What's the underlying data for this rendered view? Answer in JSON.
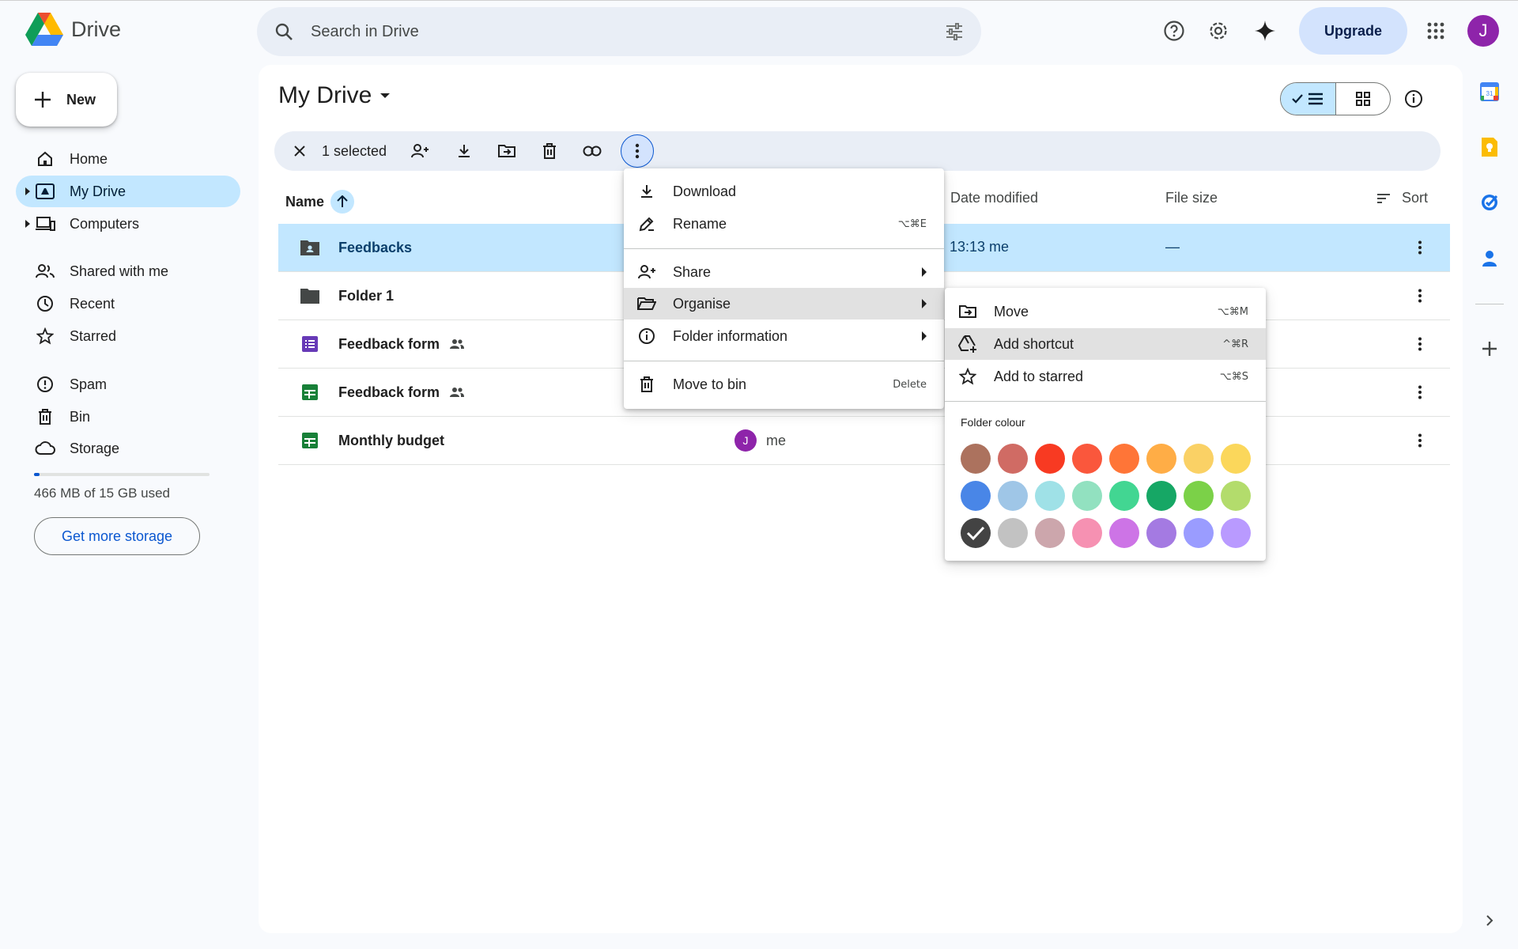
{
  "app": {
    "name": "Drive"
  },
  "search": {
    "placeholder": "Search in Drive"
  },
  "header": {
    "upgrade_label": "Upgrade",
    "avatar_initial": "J"
  },
  "sidebar": {
    "new_label": "New",
    "items": [
      {
        "label": "Home"
      },
      {
        "label": "My Drive"
      },
      {
        "label": "Computers"
      },
      {
        "label": "Shared with me"
      },
      {
        "label": "Recent"
      },
      {
        "label": "Starred"
      },
      {
        "label": "Spam"
      },
      {
        "label": "Bin"
      },
      {
        "label": "Storage"
      }
    ],
    "storage_used_fraction": 0.03,
    "storage_text": "466 MB of 15 GB used",
    "get_more_storage": "Get more storage"
  },
  "main": {
    "title": "My Drive",
    "selection_count": "1 selected",
    "columns": {
      "name": "Name",
      "date_modified": "Date modified",
      "file_size": "File size",
      "sort": "Sort"
    },
    "rows": [
      {
        "name": "Feedbacks",
        "type": "shared-folder",
        "date_modified": "13:13 me",
        "file_size": "—",
        "shared": false,
        "selected": true
      },
      {
        "name": "Folder 1",
        "type": "folder",
        "shared": false
      },
      {
        "name": "Feedback form",
        "type": "forms",
        "shared": true
      },
      {
        "name": "Feedback form",
        "type": "sheets",
        "shared": true
      },
      {
        "name": "Monthly budget",
        "type": "sheets",
        "shared": false,
        "owner": "me",
        "owner_initial": "J"
      }
    ]
  },
  "context_menu": {
    "items": [
      {
        "label": "Download",
        "icon": "download-icon"
      },
      {
        "label": "Rename",
        "icon": "rename-icon",
        "shortcut": "⌥⌘E"
      },
      {
        "label": "Share",
        "icon": "share-icon",
        "submenu": true
      },
      {
        "label": "Organise",
        "icon": "organise-icon",
        "submenu": true,
        "highlighted": true
      },
      {
        "label": "Folder information",
        "icon": "info-icon",
        "submenu": true
      },
      {
        "label": "Move to bin",
        "icon": "bin-icon",
        "shortcut": "Delete"
      }
    ]
  },
  "organise_menu": {
    "items": [
      {
        "label": "Move",
        "icon": "move-icon",
        "shortcut": "⌥⌘M"
      },
      {
        "label": "Add shortcut",
        "icon": "add-shortcut-icon",
        "shortcut": "^⌘R",
        "highlighted": true
      },
      {
        "label": "Add to starred",
        "icon": "star-icon",
        "shortcut": "⌥⌘S"
      }
    ],
    "folder_colour_label": "Folder colour",
    "colours": [
      "#ac725e",
      "#d06b64",
      "#f83a22",
      "#fa573c",
      "#ff7537",
      "#ffad46",
      "#fad165",
      "#fbd75b",
      "#4986e7",
      "#9fc6e7",
      "#9fe1e7",
      "#92e1c0",
      "#42d692",
      "#16a765",
      "#7bd148",
      "#b3dc6c",
      "#434343",
      "#c2c2c2",
      "#cca6ac",
      "#f691b2",
      "#cd74e6",
      "#a47ae2",
      "#9a9cff",
      "#b99aff"
    ],
    "selected_colour_index": 16
  }
}
